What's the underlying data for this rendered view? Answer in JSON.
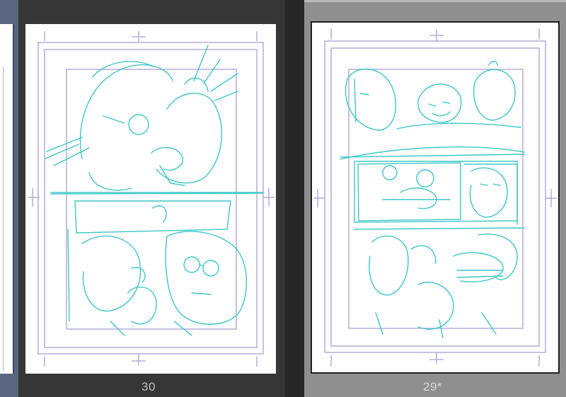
{
  "pages": [
    {
      "number": "30",
      "state": "normal",
      "label_color": "#bfbfbf"
    },
    {
      "number": "29*",
      "state": "modified",
      "label_color": "#d6d6d6"
    }
  ],
  "colors": {
    "sketch": "#3ec6c6",
    "guide": "#a7a2d3",
    "dark_panel": "#363636",
    "light_panel": "#8f8f8f"
  }
}
